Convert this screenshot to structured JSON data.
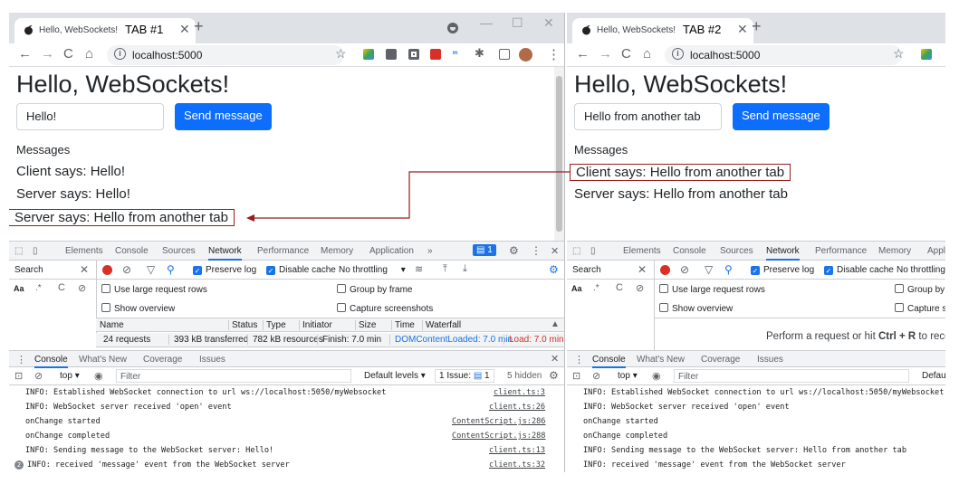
{
  "w1": {
    "tab_title": "Hello, WebSockets!",
    "tab_label": "TAB #1",
    "url": "localhost:5000",
    "heading": "Hello, WebSockets!",
    "input_value": "Hello!",
    "send": "Send message",
    "messages_header": "Messages",
    "messages": [
      "Client says: Hello!",
      "Server says: Hello!",
      "Server says: Hello from another tab"
    ],
    "devtools_tabs": [
      "Elements",
      "Console",
      "Sources",
      "Network",
      "Performance",
      "Memory",
      "Application",
      "»"
    ],
    "badge": "1",
    "search": "Search",
    "preserve_log": "Preserve log",
    "disable_cache": "Disable cache",
    "throttling": "No throttling",
    "opt_large_rows": "Use large request rows",
    "opt_group_frame": "Group by frame",
    "opt_overview": "Show overview",
    "opt_screenshots": "Capture screenshots",
    "cols": [
      "Name",
      "Status",
      "Type",
      "Initiator",
      "Size",
      "Time",
      "Waterfall"
    ],
    "status_bar": {
      "requests": "24 requests",
      "transferred": "393 kB transferred",
      "resources": "782 kB resources",
      "finish": "Finish: 7.0 min",
      "dcl": "DOMContentLoaded: 7.0 min",
      "load": "Load: 7.0 min"
    },
    "drawer_tabs": [
      "Console",
      "What's New",
      "Coverage",
      "Issues"
    ],
    "top": "top",
    "filter": "Filter",
    "levels": "Default levels",
    "issues": "1 Issue:",
    "issues_count": "1",
    "hidden": "5 hidden",
    "logs": [
      {
        "text": "INFO: Established WebSocket connection to url ws://localhost:5050/myWebsocket",
        "src": "client.ts:3"
      },
      {
        "text": "INFO: WebSocket server received 'open' event",
        "src": "client.ts:26"
      },
      {
        "text": "onChange started",
        "src": "ContentScript.js:286"
      },
      {
        "text": "onChange completed",
        "src": "ContentScript.js:288"
      },
      {
        "text": "INFO: Sending message to the WebSocket server: Hello!",
        "src": "client.ts:13"
      },
      {
        "text": "INFO: received 'message' event from the WebSocket server",
        "src": "client.ts:32",
        "count": "2"
      }
    ]
  },
  "w2": {
    "tab_title": "Hello, WebSockets!",
    "tab_label": "TAB #2",
    "url": "localhost:5000",
    "heading": "Hello, WebSockets!",
    "input_value": "Hello from another tab",
    "send": "Send message",
    "messages_header": "Messages",
    "messages": [
      "Client says: Hello from another tab",
      "Server says: Hello from another tab"
    ],
    "devtools_tabs": [
      "Elements",
      "Console",
      "Sources",
      "Network",
      "Performance",
      "Memory",
      "Appli"
    ],
    "search": "Search",
    "preserve_log": "Preserve log",
    "disable_cache": "Disable cache",
    "throttling": "No throttling",
    "opt_large_rows": "Use large request rows",
    "opt_group_frame": "Group by",
    "opt_overview": "Show overview",
    "opt_screenshots": "Capture sc",
    "empty_hint_a": "Perform a request or hit ",
    "empty_hint_b": "Ctrl + R",
    "empty_hint_c": " to recor",
    "drawer_tabs": [
      "Console",
      "What's New",
      "Coverage",
      "Issues"
    ],
    "top": "top",
    "filter": "Filter",
    "levels": "Defau",
    "logs": [
      {
        "text": "INFO: Established WebSocket connection to url ws://localhost:5050/myWebsocket"
      },
      {
        "text": "INFO: WebSocket server received 'open' event"
      },
      {
        "text": "onChange started"
      },
      {
        "text": "onChange completed"
      },
      {
        "text": "INFO: Sending message to the WebSocket server: Hello from another tab"
      },
      {
        "text": "INFO: received 'message' event from the WebSocket server"
      }
    ]
  },
  "colors": {
    "accent": "#1a73e8",
    "bootstrap_primary": "#0d6efd",
    "highlight": "#9b1c1c",
    "load_red": "#d93025"
  }
}
